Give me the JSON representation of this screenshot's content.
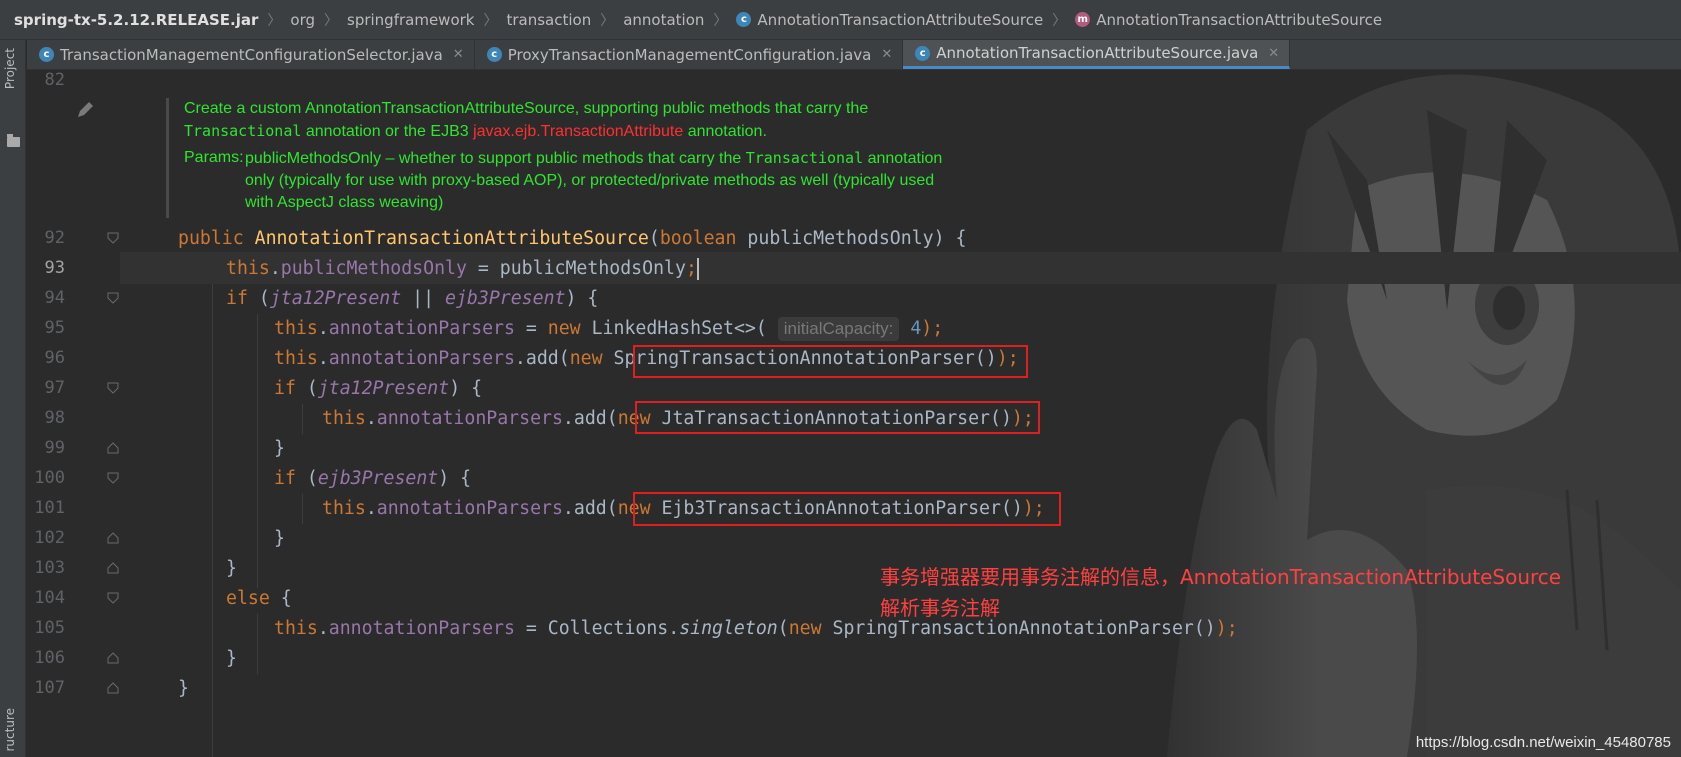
{
  "breadcrumb": {
    "jar": "spring-tx-5.2.12.RELEASE.jar",
    "items": [
      "org",
      "springframework",
      "transaction",
      "annotation",
      "AnnotationTransactionAttributeSource",
      "AnnotationTransactionAttributeSource"
    ],
    "icons": [
      "class-icon",
      "method-icon"
    ]
  },
  "tabs": [
    {
      "label": "TransactionManagementConfigurationSelector.java",
      "active": false
    },
    {
      "label": "ProxyTransactionManagementConfiguration.java",
      "active": false
    },
    {
      "label": "AnnotationTransactionAttributeSource.java",
      "active": true
    }
  ],
  "sidebar": {
    "project": "Project",
    "structure": "ructure"
  },
  "doc": {
    "line1": "Create a custom AnnotationTransactionAttributeSource, supporting public methods that carry the",
    "transactional": "Transactional",
    "line2a": " annotation or the EJB3 ",
    "ejb_link": "javax.ejb.TransactionAttribute",
    "line2b": " annotation.",
    "params_label": "Params:",
    "params_text": "publicMethodsOnly – whether to support public methods that carry the ",
    "params_text2": " annotation only (typically for use with proxy-based AOP), or protected/private methods as well (typically used with AspectJ class weaving)"
  },
  "gutter": [
    "82",
    "92",
    "93",
    "94",
    "95",
    "96",
    "97",
    "98",
    "99",
    "100",
    "101",
    "102",
    "103",
    "104",
    "105",
    "106",
    "107"
  ],
  "code": {
    "public": "public",
    "ctor": "AnnotationTransactionAttributeSource",
    "boolean": "boolean",
    "param": "publicMethodsOnly",
    "this": "this",
    "field_pmo": "publicMethodsOnly",
    "if": "if",
    "jta": "jta12Present",
    "ejb": "ejb3Present",
    "field_ap": "annotationParsers",
    "new": "new",
    "linked": "LinkedHashSet",
    "hint_label": "initialCapacity:",
    "hint_value": "4",
    "add": "add",
    "spring_parser": "SpringTransactionAnnotationParser",
    "jta_parser": "JtaTransactionAnnotationParser",
    "ejb_parser": "Ejb3TransactionAnnotationParser",
    "else": "else",
    "collections": "Collections",
    "singleton": "singleton"
  },
  "annotation_note": {
    "line1": "事务增强器要用事务注解的信息，AnnotationTransactionAttributeSource",
    "line2": "解析事务注解"
  },
  "watermark": "https://blog.csdn.net/weixin_45480785",
  "colors": {
    "background": "#2b2b2b",
    "keyword": "#cc7832",
    "method": "#ffc66d",
    "field": "#9876aa",
    "doc": "#2fe52f",
    "highlight_box": "#e02020"
  }
}
